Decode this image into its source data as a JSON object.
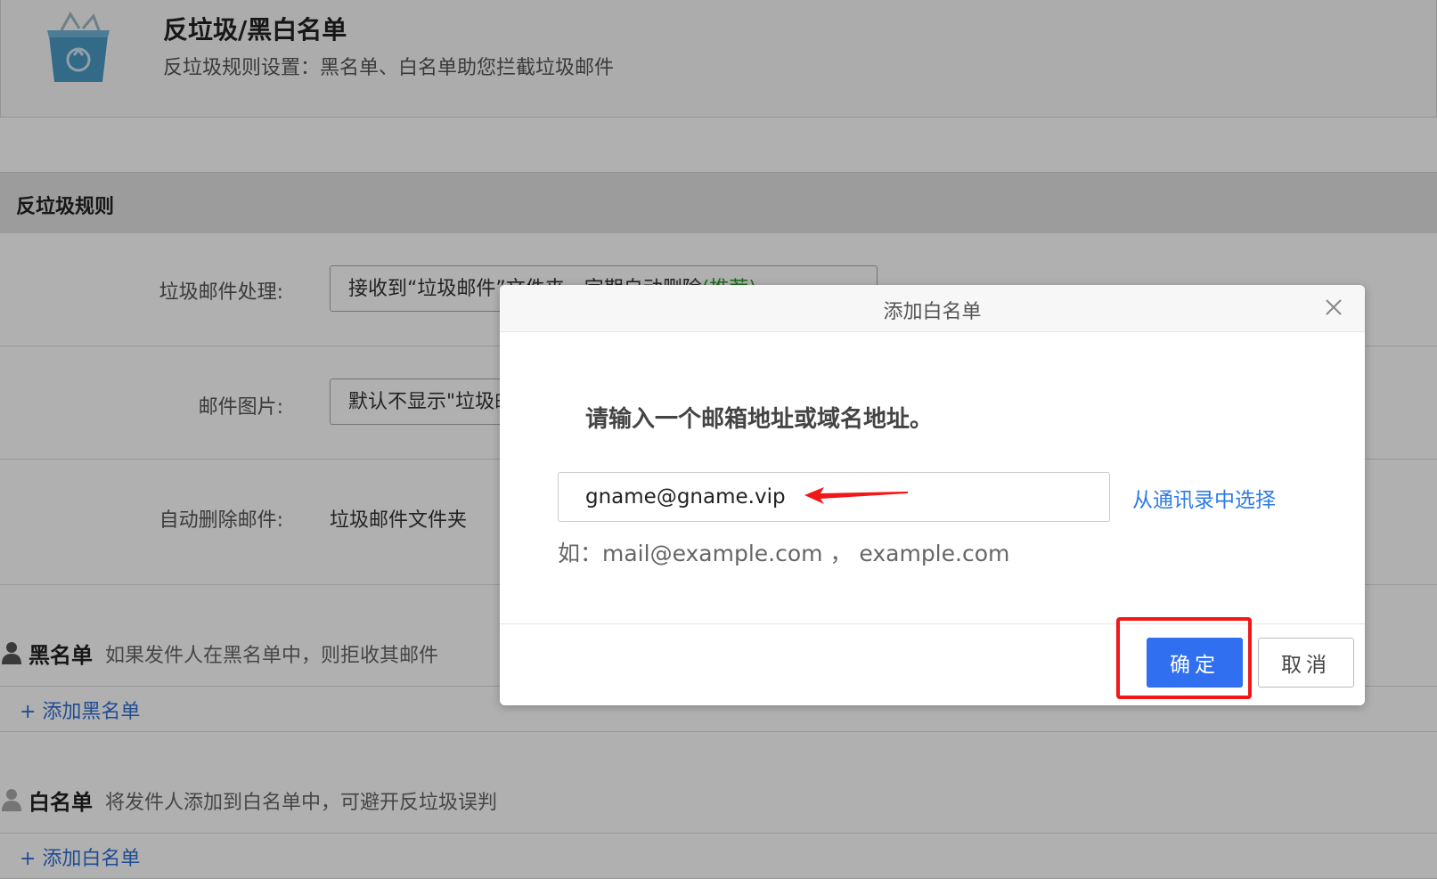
{
  "header": {
    "title": "反垃圾/黑白名单",
    "subtitle": "反垃圾规则设置：黑名单、白名单助您拦截垃圾邮件",
    "logo_icon": "recycle-bin-icon"
  },
  "section": {
    "title": "反垃圾规则"
  },
  "rules": {
    "spam_handling": {
      "label": "垃圾邮件处理:",
      "value": "接收到“垃圾邮件”文件夹，定期自动删除",
      "note": "(推荐)"
    },
    "mail_images": {
      "label": "邮件图片:",
      "value": "默认不显示\"垃圾邮件\"中的图片"
    },
    "auto_delete": {
      "label": "自动删除邮件:",
      "value": "垃圾邮件文件夹"
    }
  },
  "blacklist": {
    "name": "黑名单",
    "desc": "如果发件人在黑名单中，则拒收其邮件",
    "add_label": "+ 添加黑名单"
  },
  "whitelist": {
    "name": "白名单",
    "desc": "将发件人添加到白名单中，可避开反垃圾误判",
    "add_label": "+ 添加白名单"
  },
  "dialog": {
    "title": "添加白名单",
    "prompt": "请输入一个邮箱地址或域名地址。",
    "email_value": "gname@gname.vip",
    "pick_contacts": "从通讯录中选择",
    "hint": "如：mail@example.com ， example.com",
    "ok_label": "确定",
    "cancel_label": "取消"
  },
  "colors": {
    "primary": "#2f6ff0",
    "link": "#2f7be5",
    "annotation": "#f01818"
  }
}
